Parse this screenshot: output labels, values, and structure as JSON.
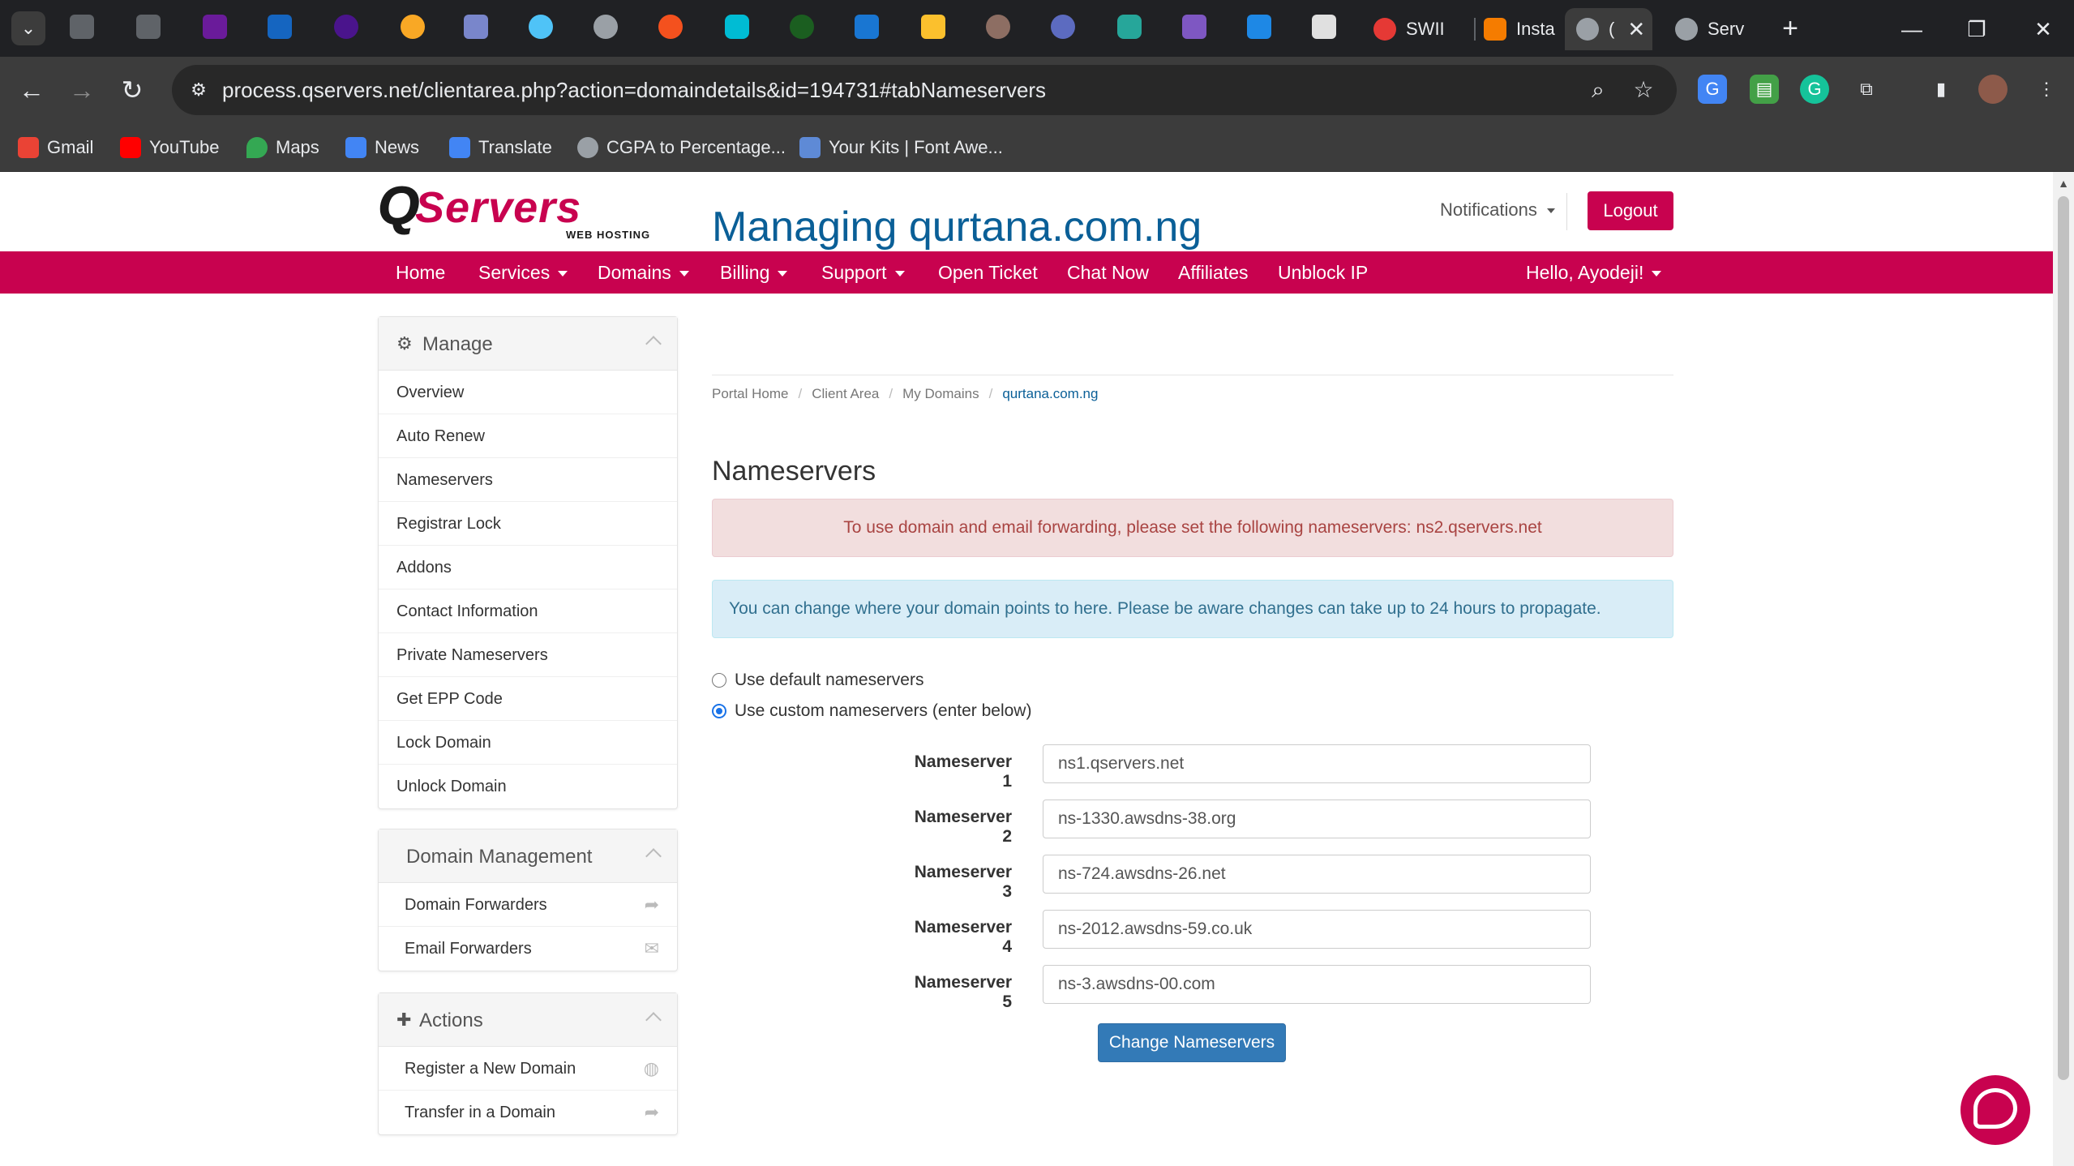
{
  "browser": {
    "tabs": [
      {
        "title": "SWII",
        "favicon_color": "#e53935"
      },
      {
        "title": "Insta",
        "favicon_color": "#f57c00"
      },
      {
        "title": "(",
        "favicon_color": "#9aa0a6",
        "active": true
      },
      {
        "title": "Serv",
        "favicon_color": "#9aa0a6"
      }
    ],
    "url": "process.qservers.net/clientarea.php?action=domaindetails&id=194731#tabNameservers",
    "bookmarks": [
      {
        "label": "Gmail",
        "color": "#ea4335"
      },
      {
        "label": "YouTube",
        "color": "#ff0000"
      },
      {
        "label": "Maps",
        "color": "#34a853"
      },
      {
        "label": "News",
        "color": "#4285f4"
      },
      {
        "label": "Translate",
        "color": "#4285f4"
      },
      {
        "label": "CGPA to Percentage...",
        "color": "#9aa0a6"
      },
      {
        "label": "Your Kits | Font Awe...",
        "color": "#5e8ad6"
      }
    ]
  },
  "site": {
    "brand_color": "#c8024f",
    "logo_text": "QServers",
    "logo_tagline": "WEB HOSTING",
    "notifications_label": "Notifications",
    "logout_label": "Logout",
    "nav": [
      {
        "label": "Home",
        "has_caret": false
      },
      {
        "label": "Services",
        "has_caret": true
      },
      {
        "label": "Domains",
        "has_caret": true
      },
      {
        "label": "Billing",
        "has_caret": true
      },
      {
        "label": "Support",
        "has_caret": true
      },
      {
        "label": "Open Ticket",
        "has_caret": false
      },
      {
        "label": "Chat Now",
        "has_caret": false
      },
      {
        "label": "Affiliates",
        "has_caret": false
      },
      {
        "label": "Unblock IP",
        "has_caret": false
      }
    ],
    "user_greeting": "Hello, Ayodeji!"
  },
  "sidebar": {
    "manage": {
      "title": "Manage",
      "icon": "gear-icon",
      "items": [
        "Overview",
        "Auto Renew",
        "Nameservers",
        "Registrar Lock",
        "Addons",
        "Contact Information",
        "Private Nameservers",
        "Get EPP Code",
        "Lock Domain",
        "Unlock Domain"
      ]
    },
    "domain_management": {
      "title": "Domain Management",
      "items": [
        {
          "label": "Domain Forwarders",
          "icon": "share-icon"
        },
        {
          "label": "Email Forwarders",
          "icon": "envelope-icon"
        }
      ]
    },
    "actions": {
      "title": "Actions",
      "icon": "plus-icon",
      "items": [
        {
          "label": "Register a New Domain",
          "icon": "globe-icon"
        },
        {
          "label": "Transfer in a Domain",
          "icon": "share-icon"
        }
      ]
    }
  },
  "main": {
    "title": "Managing qurtana.com.ng",
    "breadcrumb": [
      "Portal Home",
      "Client Area",
      "My Domains",
      "qurtana.com.ng"
    ],
    "section_title": "Nameservers",
    "alert_danger": "To use domain and email forwarding, please set the following nameservers: ns2.qservers.net",
    "alert_info": "You can change where your domain points to here. Please be aware changes can take up to 24 hours to propagate.",
    "radio_default": {
      "label": "Use default nameservers",
      "checked": false
    },
    "radio_custom": {
      "label": "Use custom nameservers (enter below)",
      "checked": true
    },
    "nameservers": [
      {
        "label": "Nameserver 1",
        "value": "ns1.qservers.net"
      },
      {
        "label": "Nameserver 2",
        "value": "ns-1330.awsdns-38.org"
      },
      {
        "label": "Nameserver 3",
        "value": "ns-724.awsdns-26.net"
      },
      {
        "label": "Nameserver 4",
        "value": "ns-2012.awsdns-59.co.uk"
      },
      {
        "label": "Nameserver 5",
        "value": "ns-3.awsdns-00.com"
      }
    ],
    "submit_label": "Change Nameservers"
  }
}
